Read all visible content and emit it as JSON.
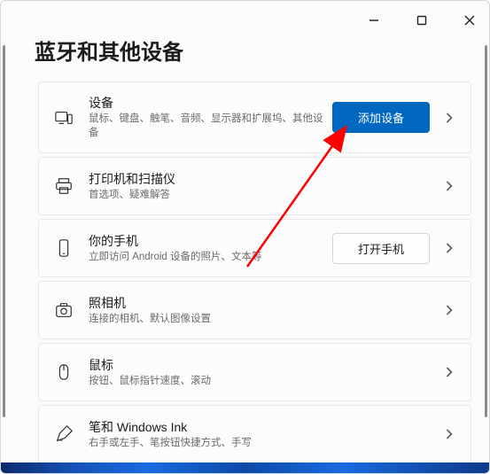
{
  "window": {
    "title": "蓝牙和其他设备"
  },
  "cards": {
    "devices": {
      "title": "设备",
      "sub": "鼠标、键盘、触笔、音频、显示器和扩展坞、其他设备",
      "action": "添加设备"
    },
    "printers": {
      "title": "打印机和扫描仪",
      "sub": "首选项、疑难解答"
    },
    "phone": {
      "title": "你的手机",
      "sub": "立即访问 Android 设备的照片、文本等",
      "action": "打开手机"
    },
    "camera": {
      "title": "照相机",
      "sub": "连接的相机、默认图像设置"
    },
    "mouse": {
      "title": "鼠标",
      "sub": "按钮、鼠标指针速度、滚动"
    },
    "pen": {
      "title": "笔和 Windows Ink",
      "sub": "右手或左手、笔按钮快捷方式、手写"
    }
  }
}
